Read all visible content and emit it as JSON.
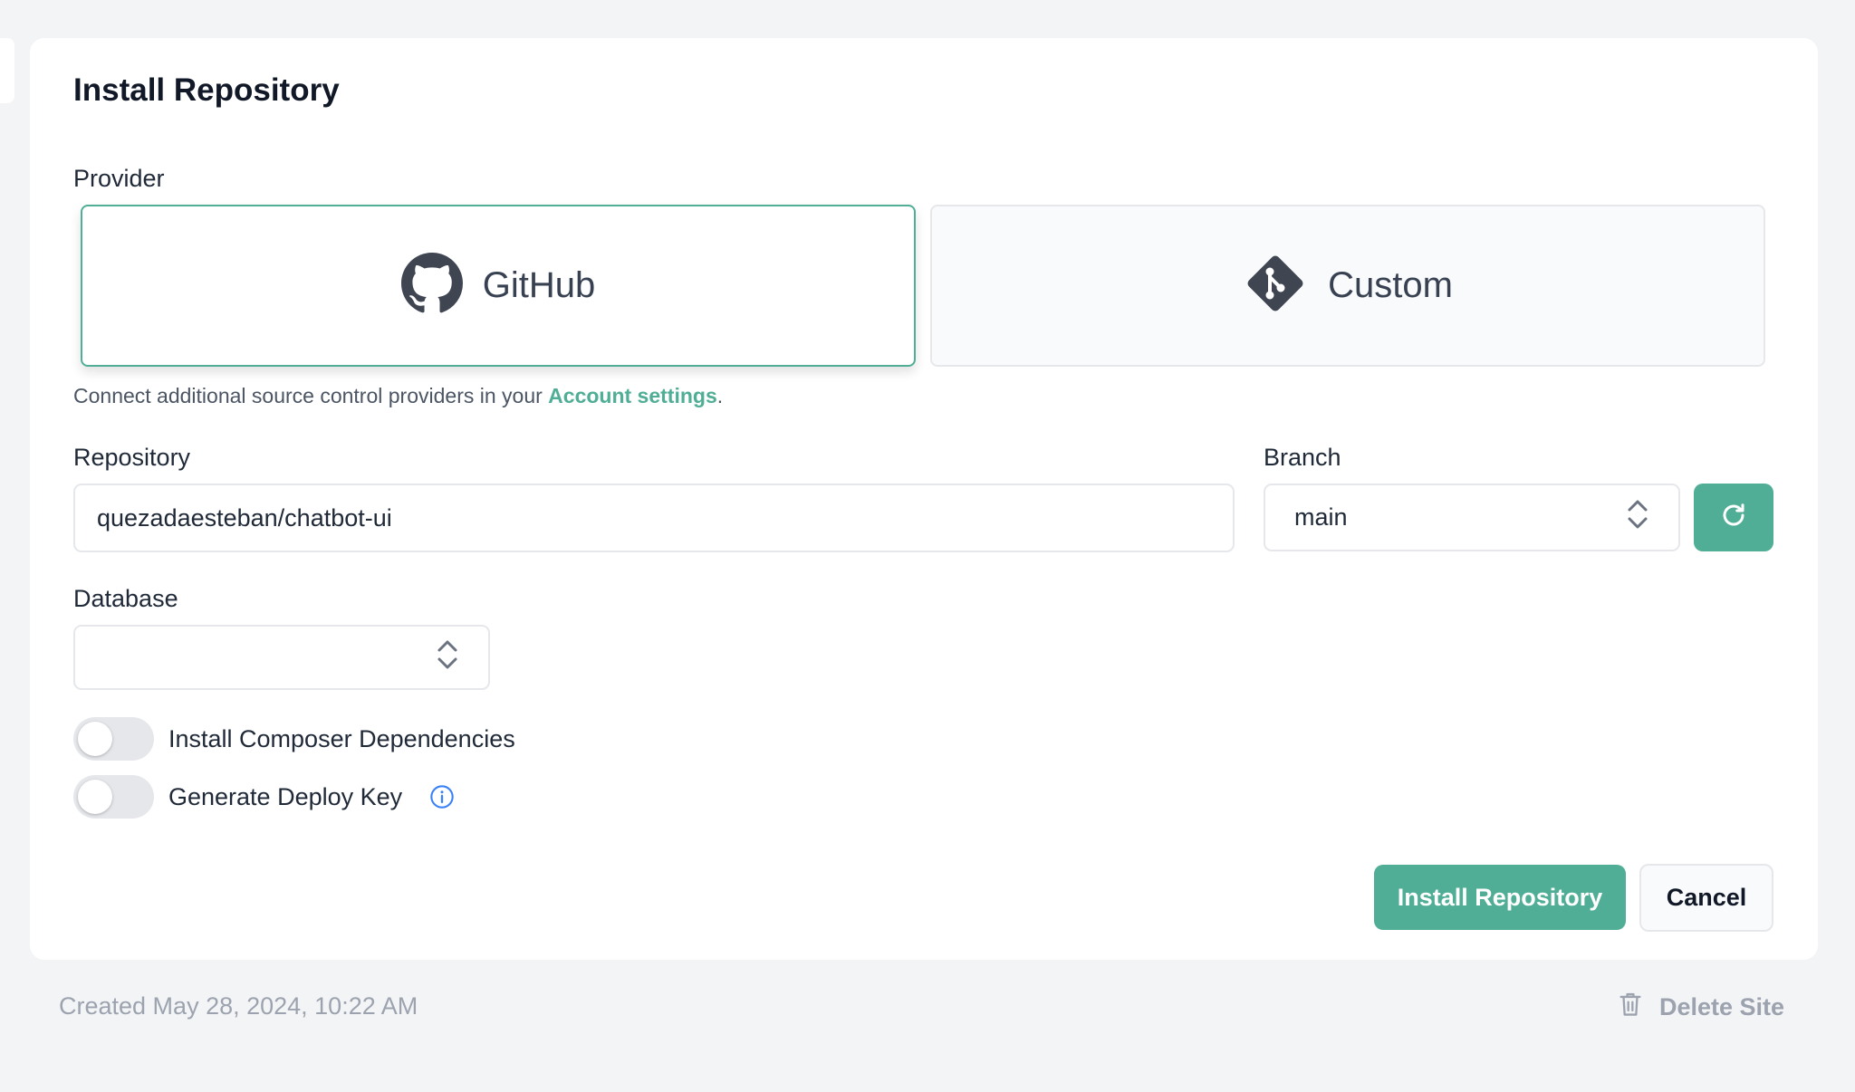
{
  "card": {
    "title": "Install Repository"
  },
  "provider": {
    "label": "Provider",
    "options": [
      {
        "label": "GitHub",
        "icon": "github-icon",
        "selected": true
      },
      {
        "label": "Custom",
        "icon": "git-icon",
        "selected": false
      }
    ],
    "help_prefix": "Connect additional source control providers in your ",
    "help_link": "Account settings",
    "help_suffix": "."
  },
  "repository": {
    "label": "Repository",
    "value": "quezadaesteban/chatbot-ui"
  },
  "branch": {
    "label": "Branch",
    "value": "main",
    "refresh_icon": "refresh-icon"
  },
  "database": {
    "label": "Database",
    "value": ""
  },
  "toggles": [
    {
      "label": "Install Composer Dependencies",
      "on": false
    },
    {
      "label": "Generate Deploy Key",
      "on": false,
      "has_info": true
    }
  ],
  "actions": {
    "install_label": "Install Repository",
    "cancel_label": "Cancel"
  },
  "footer": {
    "created": "Created May 28, 2024, 10:22 AM",
    "delete_label": "Delete Site",
    "delete_icon": "trash-icon"
  },
  "colors": {
    "accent": "#4fae95",
    "muted_text": "#9ca3af",
    "page_background": "#f3f4f6"
  }
}
